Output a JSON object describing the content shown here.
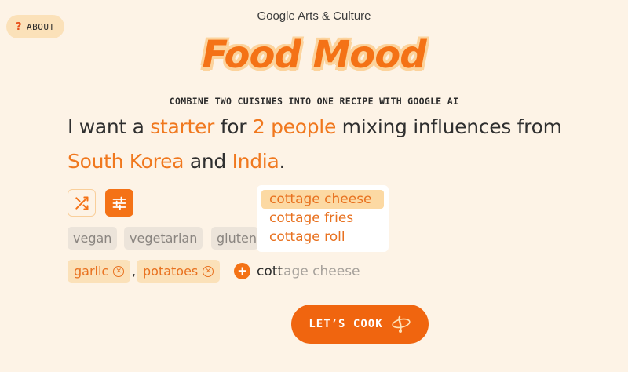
{
  "header": {
    "about_label": "ABOUT",
    "about_icon": "question-mark-icon",
    "brand": "Google Arts & Culture",
    "logo_text": "Food Mood",
    "tagline": "COMBINE TWO CUISINES INTO ONE RECIPE WITH GOOGLE AI"
  },
  "sentence": {
    "part1": "I want a ",
    "course": "starter",
    "part2": " for ",
    "people": "2 people",
    "part3": " mixing influences from ",
    "cuisine1": "South Korea",
    "part4": " and ",
    "cuisine2": "India",
    "part5": "."
  },
  "controls": {
    "shuffle_icon": "shuffle-icon",
    "filters_icon": "sliders-icon"
  },
  "dietary_chips": [
    "vegan",
    "vegetarian",
    "gluten"
  ],
  "ingredients": {
    "tags": [
      "garlic",
      "potatoes"
    ],
    "separator": ",",
    "add_symbol": "+",
    "input_typed": "cott",
    "input_ghost": "age cheese",
    "suggestions": [
      "cottage cheese",
      "cottage fries",
      "cottage roll"
    ]
  },
  "cta": {
    "label": "LET’S COOK",
    "icon": "whisk-icon"
  },
  "colors": {
    "accent": "#f47216",
    "background": "#fdf3e6",
    "tag_bg": "#fbe1b9",
    "chip_bg": "#ece4da"
  }
}
